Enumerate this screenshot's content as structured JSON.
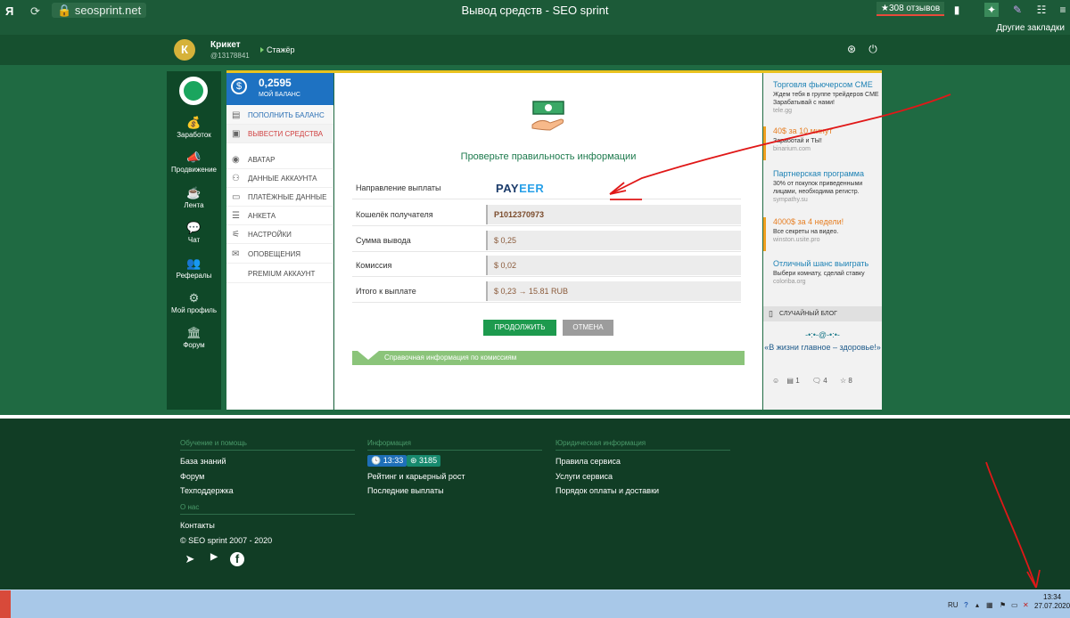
{
  "browser": {
    "url": "seosprint.net",
    "title": "Вывод средств - SEO sprint",
    "reviews": "★308 отзывов",
    "bookmarks": "Другие закладки",
    "yandex": "Я"
  },
  "user": {
    "initial": "К",
    "name": "Крикет",
    "id": "@13178841",
    "rank": "Стажёр"
  },
  "leftnav": [
    {
      "label": "Заработок"
    },
    {
      "label": "Продвижение"
    },
    {
      "label": "Лента"
    },
    {
      "label": "Чат"
    },
    {
      "label": "Рефералы"
    },
    {
      "label": "Мой профиль"
    },
    {
      "label": "Форум"
    }
  ],
  "sidebar": {
    "balance_value": "0,2595",
    "balance_label": "МОЙ БАЛАНС",
    "items": [
      {
        "label": "ПОПОЛНИТЬ БАЛАНС"
      },
      {
        "label": "ВЫВЕСТИ СРЕДСТВА"
      },
      {
        "label": "АВАТАР"
      },
      {
        "label": "ДАННЫЕ АККАУНТА"
      },
      {
        "label": "ПЛАТЁЖНЫЕ ДАННЫЕ"
      },
      {
        "label": "АНКЕТА"
      },
      {
        "label": "НАСТРОЙКИ"
      },
      {
        "label": "ОПОВЕЩЕНИЯ"
      },
      {
        "label": "PREMIUM АККАУНТ"
      }
    ]
  },
  "main": {
    "heading": "Проверьте правильность информации",
    "rows": [
      {
        "label": "Направление выплаты",
        "value": "PAYEER"
      },
      {
        "label": "Кошелёк получателя",
        "value": "P1012370973"
      },
      {
        "label": "Сумма вывода",
        "value": "$ 0,25"
      },
      {
        "label": "Комиссия",
        "value": "$ 0,02"
      },
      {
        "label": "Итого к выплате",
        "value": "$ 0,23 → 15.81 RUB"
      }
    ],
    "payeer_left": "PAY",
    "payeer_right": "EER",
    "continue_label": "ПРОДОЛЖИТЬ",
    "cancel_label": "ОТМЕНА",
    "info_label": "Справочная информация по комиссиям"
  },
  "ads": [
    {
      "title": "Торговля фьючерсом CME",
      "desc": "Ждем тебя в группе трейдеров CME Зарабатывай с нами!",
      "url": "tele.gg"
    },
    {
      "title": "40$ за 10 минут",
      "desc": "Заработай и ТЫ!",
      "url": "binarium.com"
    },
    {
      "title": "Партнерская программа",
      "desc": "30% от покупок приведенными лицами, необходима регистр.",
      "url": "sympathy.su"
    },
    {
      "title": "4000$ за 4 недели!",
      "desc": "Все секреты на видео.",
      "url": "winston.usite.pro"
    },
    {
      "title": "Отличный шанс выиграть",
      "desc": "Выбери комнату, сделай ставку",
      "url": "coloriba.org"
    }
  ],
  "blog": {
    "header": "СЛУЧАЙНЫЙ БЛОГ",
    "deco": "-•:•-@-•:•-",
    "text": "«В жизни главное – здоровье!»",
    "comments": "1",
    "replies": "4",
    "stars": "8"
  },
  "footer": {
    "col1_title": "Обучение и помощь",
    "col1_links": [
      "База знаний",
      "Форум",
      "Техподдержка"
    ],
    "about_title": "О нас",
    "contacts": "Контакты",
    "copyright": "© SEO sprint 2007 - 2020",
    "col2_title": "Информация",
    "time_badge": "13:33",
    "count_badge": "3185",
    "col2_links": [
      "Рейтинг и карьерный рост",
      "Последние выплаты"
    ],
    "col3_title": "Юридическая информация",
    "col3_links": [
      "Правила сервиса",
      "Услуги сервиса",
      "Порядок оплаты и доставки"
    ]
  },
  "taskbar": {
    "lang": "RU",
    "time": "13:34",
    "date": "27.07.2020"
  }
}
